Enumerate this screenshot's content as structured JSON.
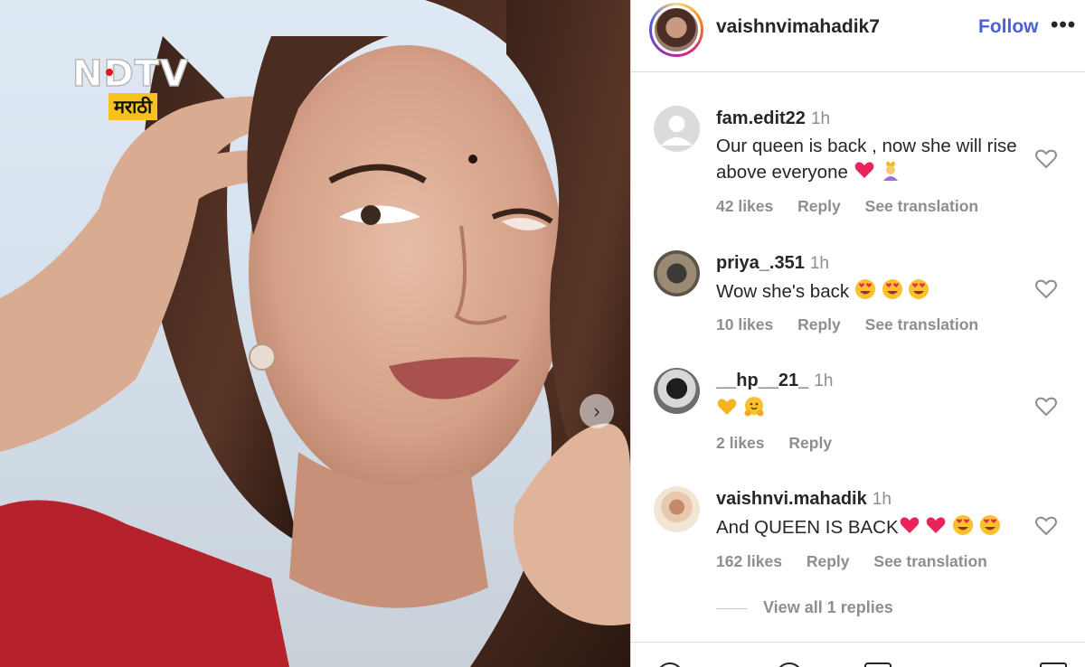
{
  "photo": {
    "logo_text": "NDTV",
    "logo_tag": "मराठी",
    "next_arrow": "chevron-right-icon"
  },
  "header": {
    "username": "vaishnvimahadik7",
    "follow_label": "Follow",
    "more_label": "•••"
  },
  "comments": [
    {
      "username": "fam.edit22",
      "time": "1h",
      "text": "Our queen is back , now she will rise above everyone",
      "emojis": [
        "heart-emoji",
        "woman-with-crown-emoji"
      ],
      "likes": "42 likes",
      "reply": "Reply",
      "translation": "See translation"
    },
    {
      "username": "priya_.351",
      "time": "1h",
      "text": "Wow she's back",
      "emojis": [
        "heart-eyes-emoji",
        "heart-eyes-emoji",
        "heart-eyes-emoji"
      ],
      "likes": "10 likes",
      "reply": "Reply",
      "translation": "See translation"
    },
    {
      "username": "__hp__21_",
      "time": "1h",
      "text": "",
      "emojis": [
        "yellow-heart-emoji",
        "hugging-face-emoji"
      ],
      "likes": "2 likes",
      "reply": "Reply"
    },
    {
      "username": "vaishnvi.mahadik",
      "time": "1h",
      "text": "And QUEEN IS BACK",
      "emojis": [
        "heart-emoji",
        "heart-emoji",
        "heart-eyes-emoji",
        "heart-eyes-emoji"
      ],
      "likes": "162 likes",
      "reply": "Reply",
      "translation": "See translation"
    }
  ],
  "view_replies": "View all 1 replies",
  "colors": {
    "follow": "#4a5fd8",
    "muted": "#8e8e8e",
    "text": "#262626",
    "heart": "#e8245a",
    "logo_tag": "#f6c21b"
  }
}
